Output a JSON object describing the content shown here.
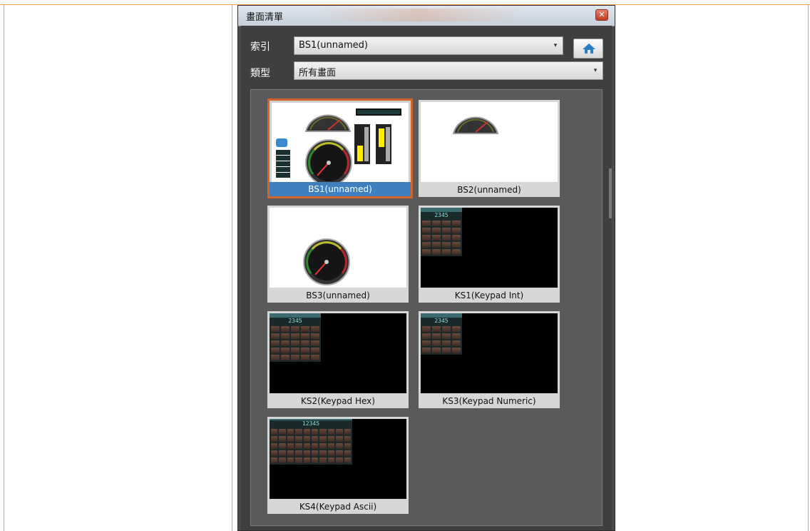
{
  "window": {
    "title": "畫面清單"
  },
  "index_row": {
    "label": "索引",
    "value": "BS1(unnamed)"
  },
  "type_row": {
    "label": "類型",
    "value": "所有畫面"
  },
  "icons": {
    "home": "home-icon",
    "close": "close-icon",
    "dropdown": "chevron-down-icon"
  },
  "screens": [
    {
      "name": "BS1(unnamed)",
      "selected": true
    },
    {
      "name": "BS2(unnamed)"
    },
    {
      "name": "BS3(unnamed)"
    },
    {
      "name": "KS1(Keypad Int)"
    },
    {
      "name": "KS2(Keypad Hex)"
    },
    {
      "name": "KS3(Keypad Numeric)"
    },
    {
      "name": "KS4(Keypad Ascii)"
    }
  ],
  "keypad_display": {
    "numeric": "2345",
    "ascii": "12345"
  },
  "colors": {
    "selection_border": "#d2642c",
    "selection_label": "#3d7fbf",
    "doc_border": "#f0a050"
  }
}
